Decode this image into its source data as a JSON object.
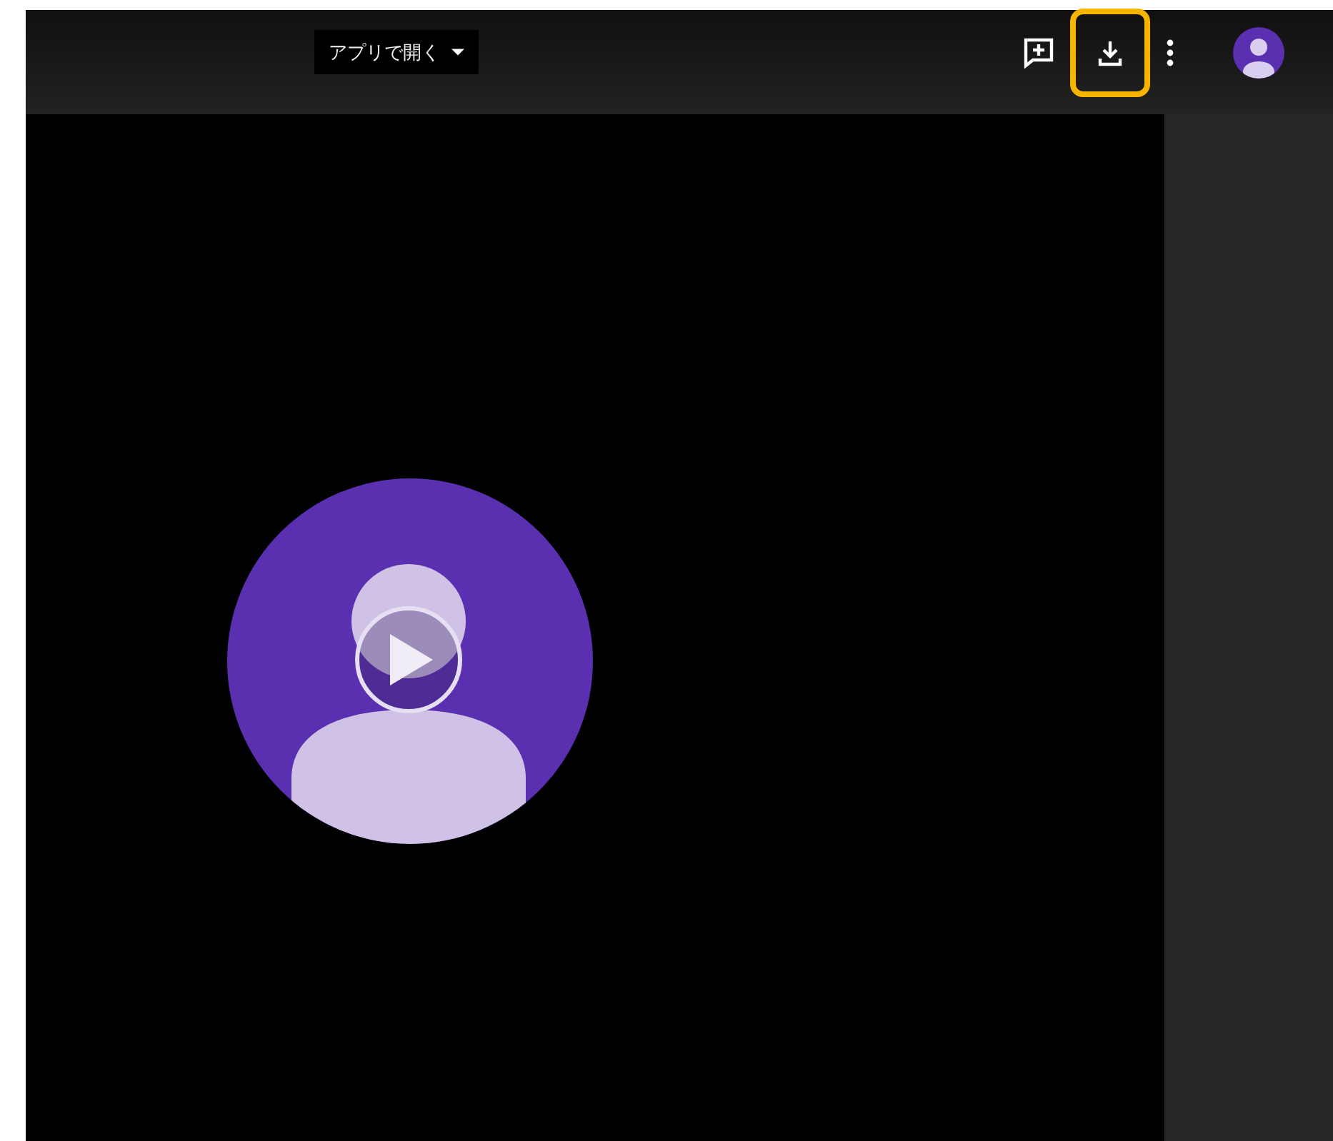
{
  "toolbar": {
    "open_with": {
      "label": "アプリで開く"
    },
    "actions": [
      {
        "kind": "comment",
        "highlighted": false
      },
      {
        "kind": "download",
        "highlighted": true
      },
      {
        "kind": "more",
        "highlighted": false
      },
      {
        "kind": "account",
        "highlighted": false
      }
    ]
  }
}
